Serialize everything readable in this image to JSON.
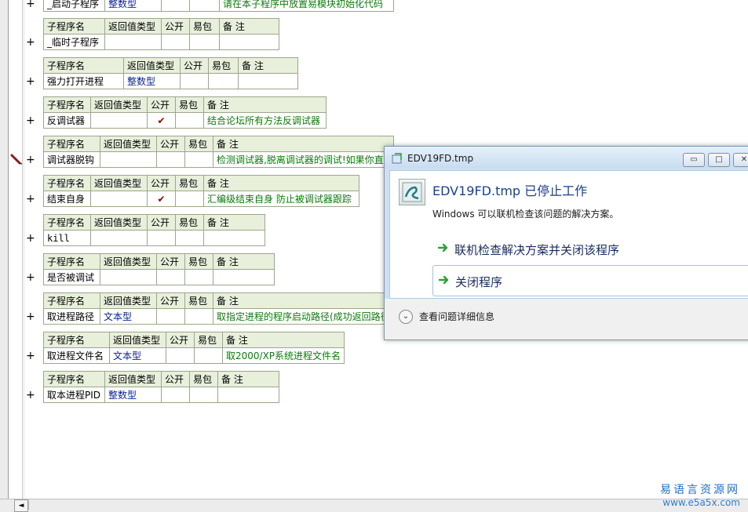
{
  "headers": {
    "name": "子程序名",
    "ret": "返回值类型",
    "pub": "公开",
    "easy": "易包",
    "note": "备 注"
  },
  "plus_sign": "+",
  "check_mark": "✔",
  "subs": [
    {
      "name": "_启动子程序",
      "type": "整数型",
      "pub": "",
      "note": "请在本子程序中放置易模块初始化代码"
    },
    {
      "name": "_临时子程序",
      "type": "",
      "pub": "",
      "note": ""
    },
    {
      "name": "强力打开进程",
      "type": "整数型",
      "pub": "",
      "note": ""
    },
    {
      "name": "反调试器",
      "type": "",
      "pub": "✔",
      "note": "结合论坛所有方法反调试器"
    },
    {
      "name": "调试器脱钩",
      "type": "",
      "pub": "",
      "note": "检测调试器,脱离调试器的调试!如果你直"
    },
    {
      "name": "结束自身",
      "type": "",
      "pub": "✔",
      "note": "汇编级结束自身 防止被调试器跟踪"
    },
    {
      "name": "kill",
      "type": "",
      "pub": "",
      "note": ""
    },
    {
      "name": "是否被调试",
      "type": "",
      "pub": "",
      "note": ""
    },
    {
      "name": "取进程路径",
      "type": "文本型",
      "pub": "",
      "note": "取指定进程的程序启动路径(成功返回路径"
    },
    {
      "name": "取进程文件名",
      "type": "文本型",
      "pub": "",
      "note": "取2000/XP系统进程文件名"
    },
    {
      "name": "取本进程PID",
      "type": "整数型",
      "pub": "",
      "note": ""
    }
  ],
  "dialog": {
    "window_title": "EDV19FD.tmp",
    "heading": "EDV19FD.tmp 已停止工作",
    "subtext": "Windows 可以联机检查该问题的解决方案。",
    "option1": "联机检查解决方案并关闭该程序",
    "option2": "关闭程序",
    "details": "查看问题详细信息",
    "min_glyph": "▭",
    "max_glyph": "□",
    "close_glyph": "✕",
    "chevron_glyph": "⌄"
  },
  "watermark": {
    "brand": "易语言资源网",
    "url": "www.e5a5x.com"
  },
  "scrollbar": {
    "left_arrow": "◄"
  },
  "colors": {
    "header_bg": "#e8f0dc",
    "type_text": "#0a1f8f",
    "note_text": "#0a7a0a",
    "check": "#8b0000",
    "accent": "#1b3f8c"
  }
}
